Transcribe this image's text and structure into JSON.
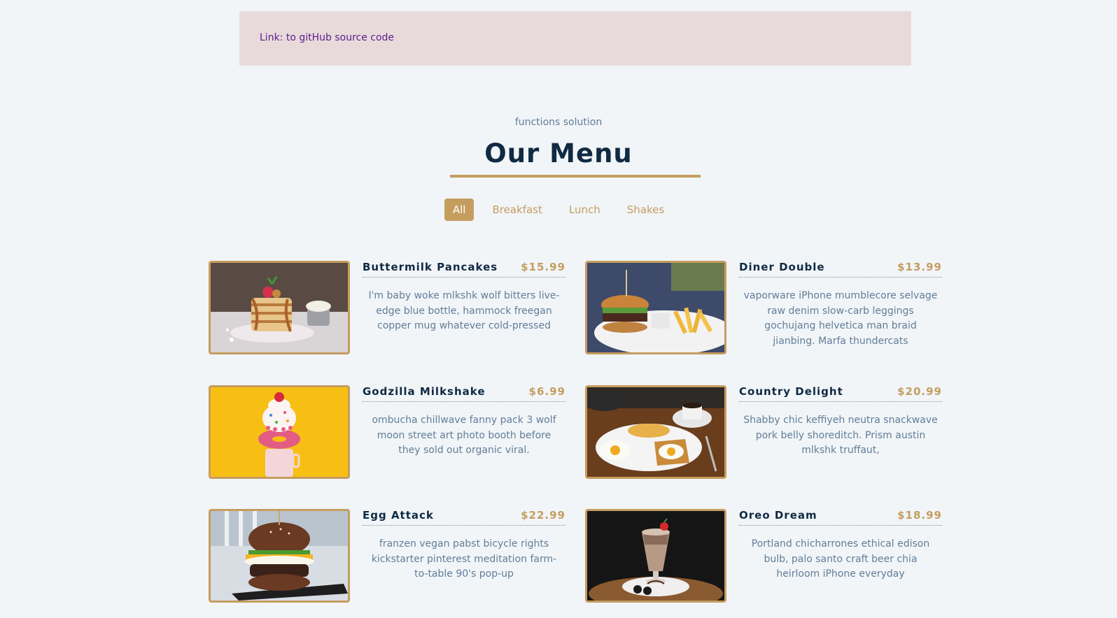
{
  "banner": {
    "link_text": "Link: to gitHub source code"
  },
  "header": {
    "subtitle": "functions solution",
    "title": "Our Menu"
  },
  "filters": [
    "All",
    "Breakfast",
    "Lunch",
    "Shakes"
  ],
  "active_filter": "All",
  "colors": {
    "accent": "#c59d5f",
    "background": "#f1f5f8",
    "heading": "#102a42",
    "body_text": "#617d98",
    "banner_bg": "#e8dadb"
  },
  "items": [
    {
      "name": "Buttermilk Pancakes",
      "price": "$15.99",
      "desc": "I'm baby woke mlkshk wolf bitters live-edge blue bottle, hammock freegan copper mug whatever cold-pressed",
      "photo": "pancakes-photo"
    },
    {
      "name": "Diner Double",
      "price": "$13.99",
      "desc": "vaporware iPhone mumblecore selvage raw denim slow-carb leggings gochujang helvetica man braid jianbing. Marfa thundercats",
      "photo": "burger-fries-photo"
    },
    {
      "name": "Godzilla Milkshake",
      "price": "$6.99",
      "desc": "ombucha chillwave fanny pack 3 wolf moon street art photo booth before they sold out organic viral.",
      "photo": "milkshake-donut-photo"
    },
    {
      "name": "Country Delight",
      "price": "$20.99",
      "desc": "Shabby chic keffiyeh neutra snackwave pork belly shoreditch. Prism austin mlkshk truffaut,",
      "photo": "eggs-toast-photo"
    },
    {
      "name": "Egg Attack",
      "price": "$22.99",
      "desc": "franzen vegan pabst bicycle rights kickstarter pinterest meditation farm-to-table 90's pop-up",
      "photo": "egg-burger-photo"
    },
    {
      "name": "Oreo Dream",
      "price": "$18.99",
      "desc": "Portland chicharrones ethical edison bulb, palo santo craft beer chia heirloom iPhone everyday",
      "photo": "oreo-shake-photo"
    }
  ]
}
